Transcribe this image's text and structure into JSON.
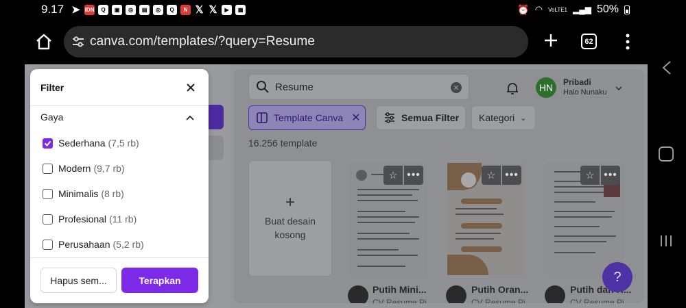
{
  "status_bar": {
    "time": "9.17",
    "battery": "50%",
    "network": "VoLTE1"
  },
  "browser": {
    "url": "canva.com/templates/?query=Resume",
    "tab_count": "62",
    "icons": [
      "home-icon",
      "tune-icon",
      "plus-icon",
      "tab-switcher-icon",
      "more-vert-icon"
    ]
  },
  "page": {
    "search": {
      "value": "Resume"
    },
    "user": {
      "initials": "HN",
      "name": "Pribadi",
      "subtitle": "Halo Nunaku",
      "avatar_color": "#2e6f2f"
    },
    "chips": {
      "template": "Template Canva",
      "filter": "Semua Filter",
      "category": "Kategori"
    },
    "template_count": "16.256 template",
    "blank_card": {
      "line1": "Buat desain",
      "line2": "kosong"
    },
    "templates": [
      {
        "title": "Putih Mini...",
        "subtitle": "CV Resume Pi..."
      },
      {
        "title": "Putih Oran...",
        "subtitle": "CV Resume Pi..."
      },
      {
        "title": "Putih dan H...",
        "subtitle": "CV Resume Pi..."
      }
    ],
    "help_label": "?"
  },
  "filter_modal": {
    "title": "Filter",
    "section": "Gaya",
    "options": [
      {
        "label": "Sederhana",
        "count": "(7,5 rb)",
        "checked": true
      },
      {
        "label": "Modern",
        "count": "(9,7 rb)",
        "checked": false
      },
      {
        "label": "Minimalis",
        "count": "(8 rb)",
        "checked": false
      },
      {
        "label": "Profesional",
        "count": "(11 rb)",
        "checked": false
      },
      {
        "label": "Perusahaan",
        "count": "(5,2 rb)",
        "checked": false
      }
    ],
    "clear_label": "Hapus sem...",
    "apply_label": "Terapkan",
    "accent_color": "#7d2ae8"
  }
}
